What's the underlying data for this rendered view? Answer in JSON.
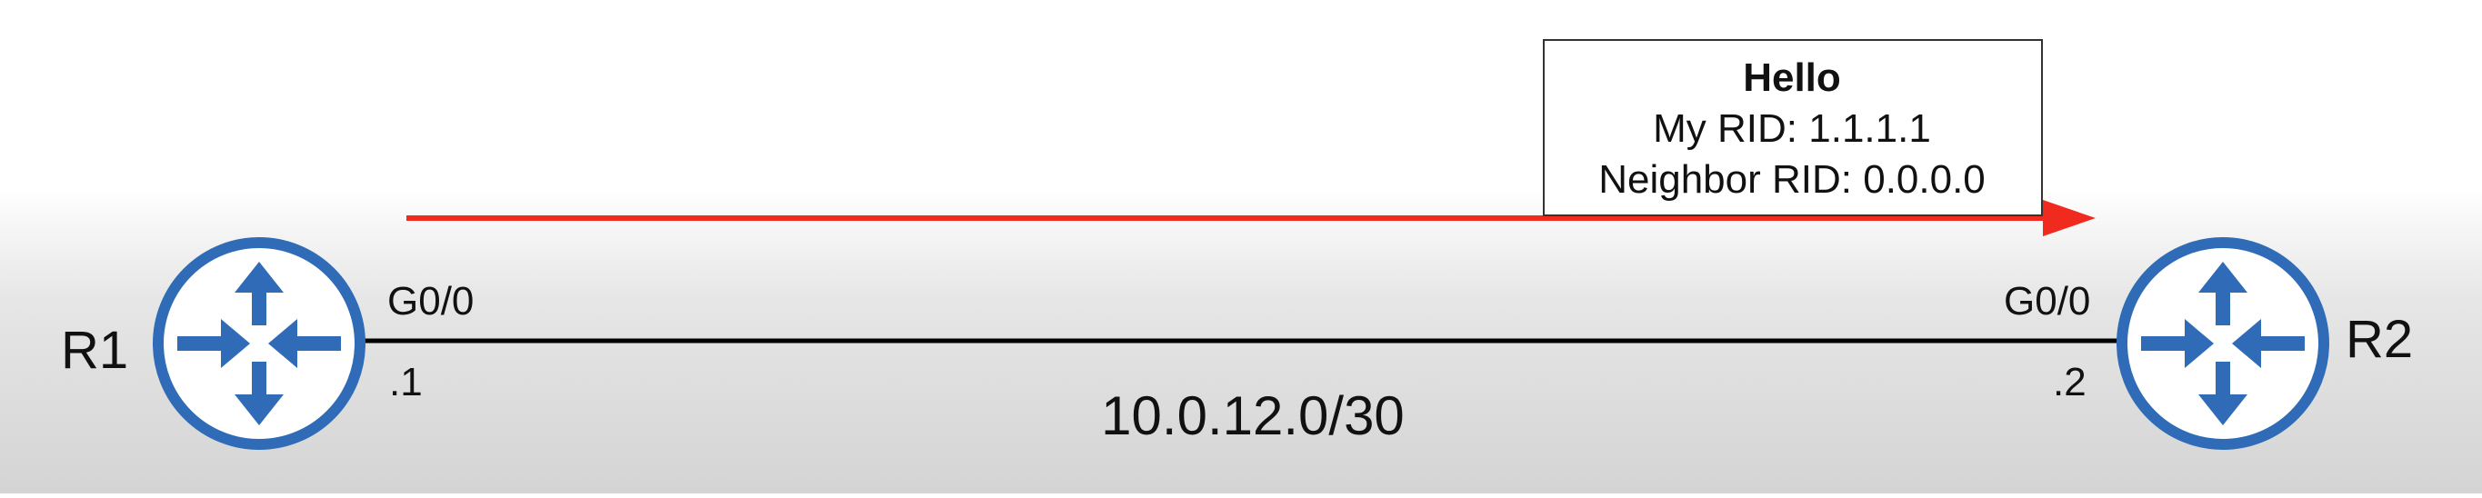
{
  "diagram": {
    "routers": {
      "r1": {
        "name": "R1",
        "interface": "G0/0",
        "host": ".1"
      },
      "r2": {
        "name": "R2",
        "interface": "G0/0",
        "host": ".2"
      }
    },
    "link": {
      "subnet": "10.0.12.0/30"
    },
    "packet": {
      "title": "Hello",
      "my_rid": "My RID: 1.1.1.1",
      "neighbor_rid": "Neighbor RID: 0.0.0.0"
    },
    "colors": {
      "router": "#2f6bb6",
      "hello_arrow": "#f02a1e",
      "link": "#000000"
    },
    "icons": {
      "router": "router-icon"
    }
  }
}
